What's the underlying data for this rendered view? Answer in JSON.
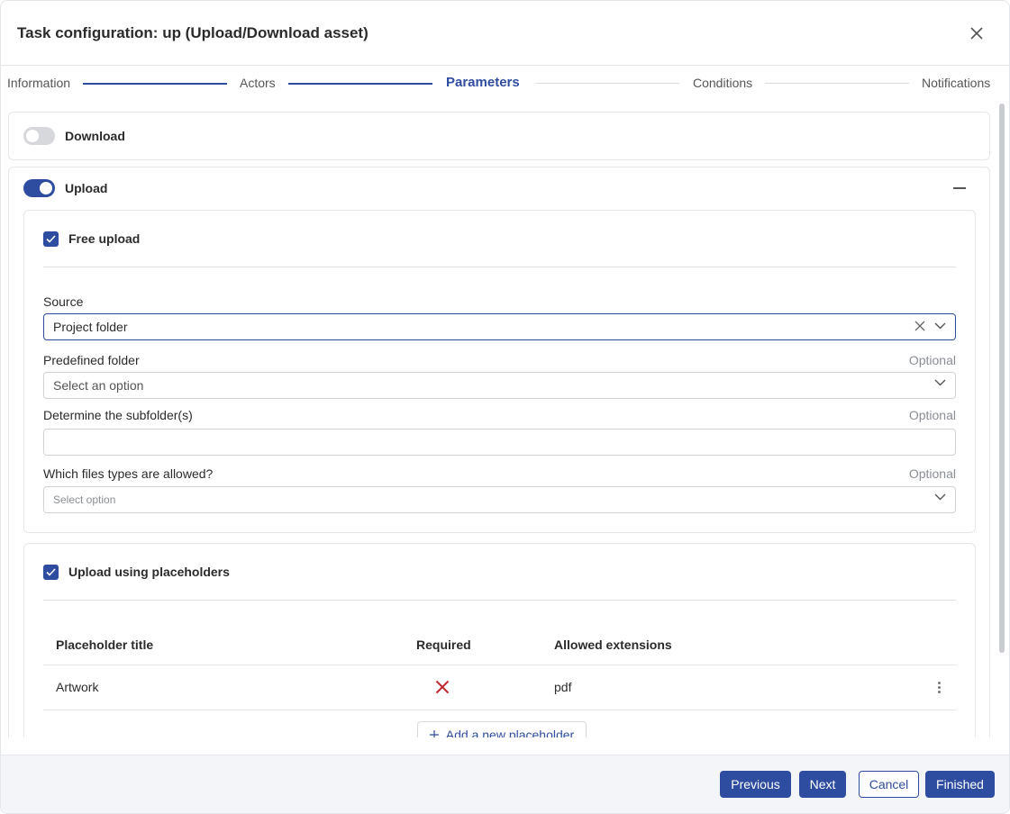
{
  "dialog": {
    "title": "Task configuration: up (Upload/Download asset)",
    "close_icon": "close-icon"
  },
  "stepper": {
    "steps": [
      {
        "label": "Information",
        "state": "done"
      },
      {
        "label": "Actors",
        "state": "done"
      },
      {
        "label": "Parameters",
        "state": "active"
      },
      {
        "label": "Conditions",
        "state": "todo"
      },
      {
        "label": "Notifications",
        "state": "todo"
      }
    ]
  },
  "download": {
    "label": "Download",
    "enabled": false
  },
  "upload": {
    "label": "Upload",
    "enabled": true,
    "free_upload": {
      "label": "Free upload",
      "checked": true,
      "source": {
        "label": "Source",
        "value": "Project folder"
      },
      "predefined_folder": {
        "label": "Predefined folder",
        "optional": "Optional",
        "placeholder": "Select an option"
      },
      "subfolder": {
        "label": "Determine the subfolder(s)",
        "optional": "Optional",
        "value": ""
      },
      "file_types": {
        "label": "Which files types are allowed?",
        "optional": "Optional",
        "placeholder": "Select option"
      }
    },
    "placeholders": {
      "label": "Upload using placeholders",
      "checked": true,
      "columns": {
        "title": "Placeholder title",
        "required": "Required",
        "extensions": "Allowed extensions"
      },
      "rows": [
        {
          "title": "Artwork",
          "required": false,
          "extensions": "pdf"
        }
      ],
      "add_label": "Add a new placeholder"
    }
  },
  "footer": {
    "previous": "Previous",
    "next": "Next",
    "cancel": "Cancel",
    "finished": "Finished"
  },
  "colors": {
    "primary": "#2f4da0",
    "required_false": "#c0262d"
  }
}
